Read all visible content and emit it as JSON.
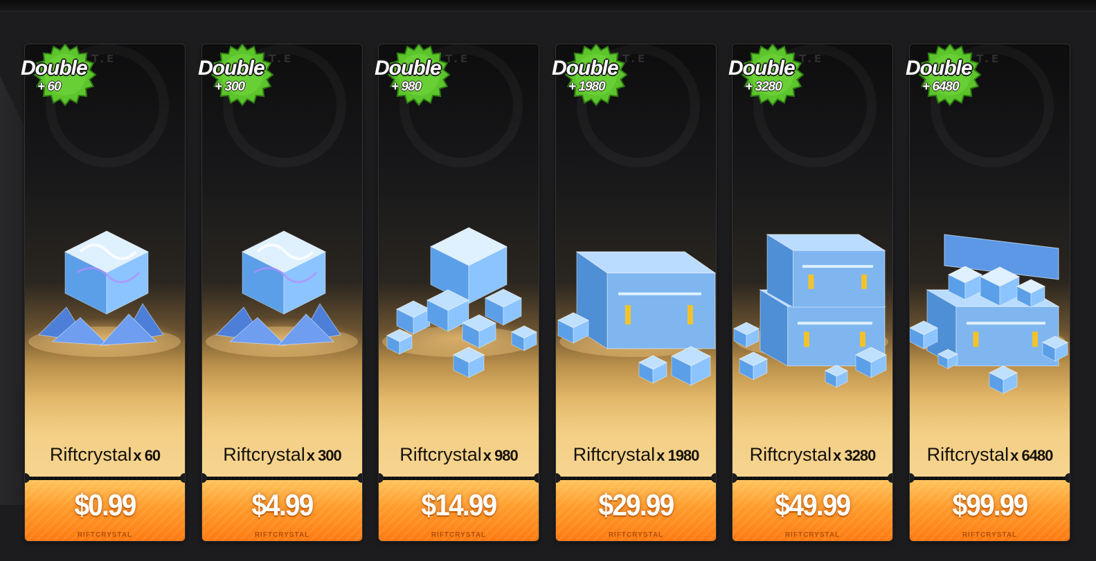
{
  "colors": {
    "background": "#1c1c1e",
    "price_orange": "#ff9c2c",
    "badge_green": "#5cc52c",
    "crystal_blue": "#6fb8ff"
  },
  "badge_title": "Double",
  "products": [
    {
      "bonus": "+ 60",
      "name": "Riftcrystal",
      "multiplier": "x 60",
      "price": "$0.99",
      "price_subtext": "RIFTCRYSTAL",
      "art": "crystal-cluster-icon"
    },
    {
      "bonus": "+ 300",
      "name": "Riftcrystal",
      "multiplier": "x 300",
      "price": "$4.99",
      "price_subtext": "RIFTCRYSTAL",
      "art": "crystal-cluster-icon"
    },
    {
      "bonus": "+ 980",
      "name": "Riftcrystal",
      "multiplier": "x 980",
      "price": "$14.99",
      "price_subtext": "RIFTCRYSTAL",
      "art": "crystal-pile-icon"
    },
    {
      "bonus": "+ 1980",
      "name": "Riftcrystal",
      "multiplier": "x 1980",
      "price": "$29.99",
      "price_subtext": "RIFTCRYSTAL",
      "art": "crystal-crate-icon"
    },
    {
      "bonus": "+ 3280",
      "name": "Riftcrystal",
      "multiplier": "x 3280",
      "price": "$49.99",
      "price_subtext": "RIFTCRYSTAL",
      "art": "stacked-crates-icon"
    },
    {
      "bonus": "+ 6480",
      "name": "Riftcrystal",
      "multiplier": "x 6480",
      "price": "$99.99",
      "price_subtext": "RIFTCRYSTAL",
      "art": "open-chest-icon"
    }
  ]
}
